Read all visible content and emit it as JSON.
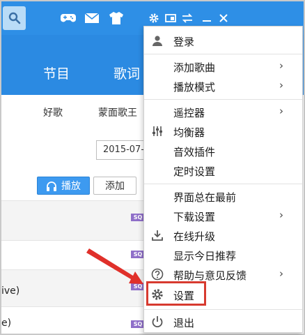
{
  "nav": {
    "tabs": [
      {
        "label": "节目"
      },
      {
        "label": "歌词"
      }
    ],
    "subtabs": [
      {
        "label": "好歌"
      },
      {
        "label": "蒙面歌王"
      }
    ]
  },
  "date_field": {
    "value": "2015-07-"
  },
  "actions": {
    "play_label": "播放",
    "add_label": "添加"
  },
  "list": {
    "badge": "SQ",
    "rows": [
      {
        "text": ""
      },
      {
        "text": ""
      },
      {
        "text": "ive)"
      },
      {
        "text": "e)"
      }
    ]
  },
  "menu": {
    "items": [
      {
        "label": "登录",
        "icon": "user-icon"
      },
      {
        "label": "添加歌曲",
        "submenu": "›"
      },
      {
        "label": "播放模式",
        "submenu": "›"
      },
      {
        "label": "遥控器",
        "submenu": "›"
      },
      {
        "label": "均衡器",
        "icon": "equalizer-icon"
      },
      {
        "label": "音效插件"
      },
      {
        "label": "定时设置"
      },
      {
        "label": "界面总在最前"
      },
      {
        "label": "下载设置",
        "submenu": "›"
      },
      {
        "label": "在线升级",
        "icon": "download-icon"
      },
      {
        "label": "显示今日推荐"
      },
      {
        "label": "帮助与意见反馈",
        "icon": "help-icon",
        "submenu": "›"
      },
      {
        "label": "设置",
        "icon": "gear-icon"
      },
      {
        "label": "退出",
        "icon": "power-icon"
      }
    ]
  },
  "colors": {
    "toolbar": "#2e8fe6",
    "accent": "#3d9af0",
    "highlight": "#d73a2f"
  }
}
